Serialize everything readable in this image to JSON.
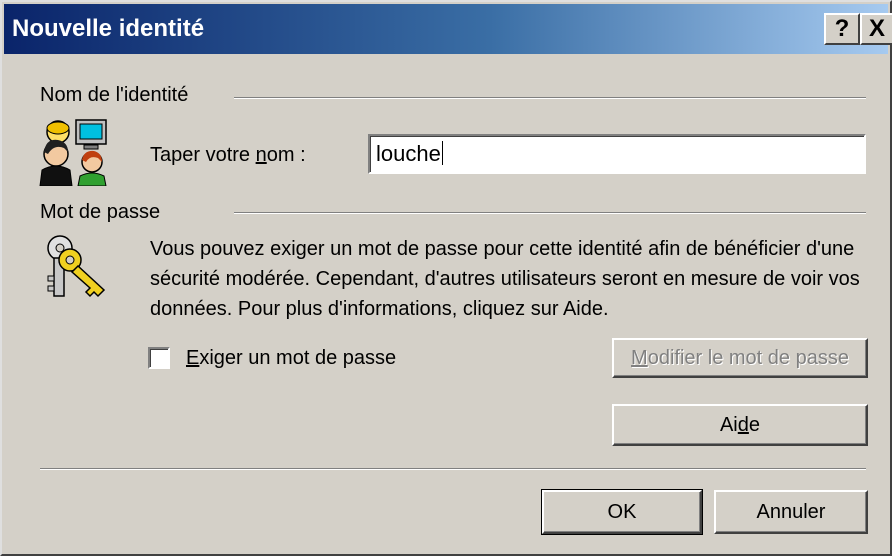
{
  "window": {
    "title": "Nouvelle identité",
    "help_glyph": "?",
    "close_glyph": "X"
  },
  "identity_group": {
    "label": "Nom de l'identité",
    "icon": "users-computer-icon",
    "name_label": "Taper votre nom :",
    "name_value": "louche"
  },
  "password_group": {
    "label": "Mot de passe",
    "icon": "keys-icon",
    "description": "Vous pouvez exiger un mot de passe pour cette identité afin de bénéficier d'une sécurité modérée. Cependant, d'autres utilisateurs seront en mesure de voir vos données. Pour plus d'informations, cliquez sur Aide.",
    "checkbox_label": "Exiger un mot de passe",
    "checkbox_checked": false,
    "modify_button": "Modifier le mot de passe",
    "help_button": "Aide"
  },
  "footer": {
    "ok_label": "OK",
    "cancel_label": "Annuler"
  }
}
